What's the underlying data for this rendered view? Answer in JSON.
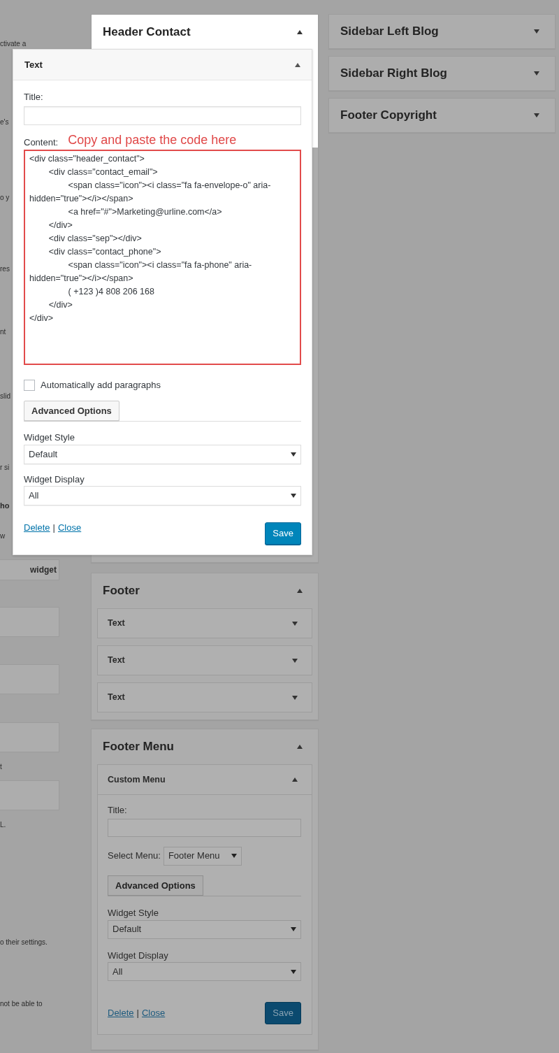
{
  "left_column": [
    {
      "kind": "fragment",
      "text": "ctivate a"
    },
    {
      "kind": "fragment",
      "text": "e's"
    },
    {
      "kind": "fragment",
      "text": "o y"
    },
    {
      "kind": "fragment",
      "text": "res"
    },
    {
      "kind": "fragment",
      "text": "nt"
    },
    {
      "kind": "fragment",
      "text": "slid"
    },
    {
      "kind": "fragment",
      "text": "r si"
    },
    {
      "kind": "heading",
      "text": "ho"
    },
    {
      "kind": "fragment",
      "text": "w"
    },
    {
      "kind": "box",
      "text": "widget"
    },
    {
      "kind": "box"
    },
    {
      "kind": "box"
    },
    {
      "kind": "box"
    },
    {
      "kind": "fragment",
      "text": "t"
    },
    {
      "kind": "box"
    },
    {
      "kind": "fragment",
      "text": "L."
    },
    {
      "kind": "fragment",
      "text": "o their settings."
    },
    {
      "kind": "fragment",
      "text": "not be able to"
    }
  ],
  "header_contact": {
    "title": "Header Contact",
    "expanded": true
  },
  "text_widget": {
    "title": "Text",
    "expanded": true,
    "title_label": "Title:",
    "content_label": "Content:",
    "annotation": "Copy and paste the code here",
    "content": [
      "<div class=\"header_contact\">",
      "\t<div class=\"contact_email\">",
      "\t\t<span class=\"icon\"><i class=\"fa fa-envelope-o\" aria-hidden=\"true\"></i></span>",
      "\t\t<a href=\"#\">Marketing@urline.com</a>",
      "\t</div>",
      "\t<div class=\"sep\"></div>",
      "\t<div class=\"contact_phone\">",
      "\t\t<span class=\"icon\"><i class=\"fa fa-phone\" aria-hidden=\"true\"></i></span>",
      "\t\t( +123 )4 808 206 168",
      "\t</div>",
      "</div>"
    ],
    "auto_paragraphs": {
      "label": "Automatically add paragraphs",
      "checked": false
    },
    "advanced_button": "Advanced Options",
    "style_label": "Widget Style",
    "style_value": "Default",
    "display_label": "Widget Display",
    "display_value": "All",
    "delete_link": "Delete",
    "separator": "|",
    "close_link": "Close",
    "save_button": "Save"
  },
  "footer": {
    "title": "Footer",
    "expanded": true,
    "widgets": [
      {
        "title": "Text",
        "expanded": false
      },
      {
        "title": "Text",
        "expanded": false
      },
      {
        "title": "Text",
        "expanded": false
      }
    ]
  },
  "footer_menu": {
    "title": "Footer Menu",
    "expanded": true,
    "widget": {
      "title": "Custom Menu",
      "expanded": true,
      "title_label": "Title:",
      "select_label": "Select Menu:",
      "select_value": "Footer Menu",
      "advanced_button": "Advanced Options",
      "style_label": "Widget Style",
      "style_value": "Default",
      "display_label": "Widget Display",
      "display_value": "All",
      "delete_link": "Delete",
      "separator": "|",
      "close_link": "Close",
      "save_button": "Save"
    }
  },
  "right_column": [
    {
      "title": "Sidebar Left Blog",
      "expanded": false
    },
    {
      "title": "Sidebar Right Blog",
      "expanded": false
    },
    {
      "title": "Footer Copyright",
      "expanded": false
    }
  ]
}
